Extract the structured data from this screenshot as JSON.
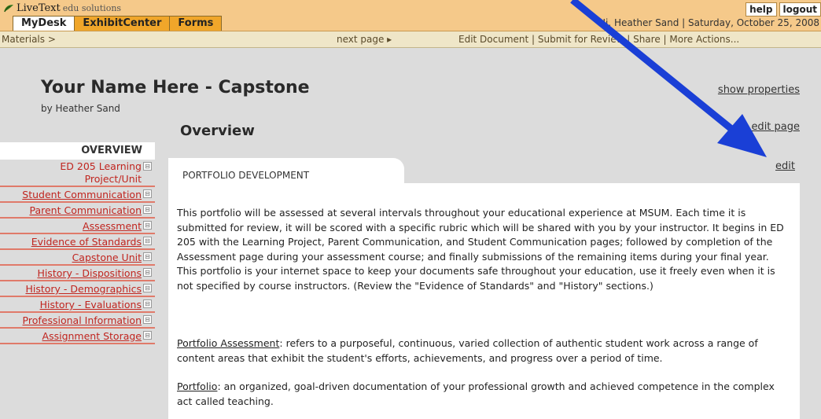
{
  "header": {
    "brand": "LiveText",
    "brand_suffix": "edu solutions",
    "help_label": "help",
    "logout_label": "logout",
    "tabs": [
      {
        "label": "MyDesk",
        "active": true
      },
      {
        "label": "ExhibitCenter",
        "active": false
      },
      {
        "label": "Forms",
        "active": false
      }
    ],
    "greeting": "Hi, Heather Sand  |  Saturday, October 25, 2008"
  },
  "subnav": {
    "materials": "Materials >",
    "next_page": "next page ▸",
    "actions": "Edit Document | Submit for Review | Share | More Actions..."
  },
  "document": {
    "title": "Your Name Here - Capstone",
    "byline": "by Heather Sand",
    "show_properties": "show properties",
    "section_title": "Overview",
    "edit_page": "edit page",
    "panel_tab": "PORTFOLIO DEVELOPMENT",
    "edit": "edit",
    "para1": "This portfolio will be assessed at several intervals throughout your educational experience at MSUM.  Each time it is submitted for review, it will be scored with a specific rubric which will be shared with you by your instructor.  It begins in ED 205 with the Learning Project, Parent Communication, and Student Communication pages; followed by completion of the Assessment page during your assessment course; and finally submissions of the remaining items during your final year.  This portfolio is your internet space to keep your documents safe throughout your education, use it freely even when it is not specified by course instructors.  (Review the \"Evidence of Standards\" and \"History\" sections.)",
    "def1_term": "Portfolio Assessment",
    "def1_text": ": refers to a purposeful, continuous, varied collection of authentic student work across a range of content areas that exhibit the student's efforts, achievements, and progress over a period of time.",
    "def2_term": "Portfolio",
    "def2_text": ": an organized, goal-driven documentation of your professional growth and achieved competence in the complex act called teaching."
  },
  "sidebar": {
    "overview": "OVERVIEW",
    "items": [
      {
        "label": "ED 205 Learning Project/Unit"
      },
      {
        "label": "Student Communication"
      },
      {
        "label": "Parent Communication"
      },
      {
        "label": "Assessment"
      },
      {
        "label": "Evidence of Standards"
      },
      {
        "label": "Capstone Unit"
      },
      {
        "label": "History - Dispositions"
      },
      {
        "label": "History - Demographics"
      },
      {
        "label": "History - Evaluations"
      },
      {
        "label": "Professional Information"
      },
      {
        "label": "Assignment Storage"
      }
    ]
  },
  "colors": {
    "arrow": "#1a3fd6",
    "link_red": "#c0251f",
    "tab_orange": "#f0a62a"
  }
}
